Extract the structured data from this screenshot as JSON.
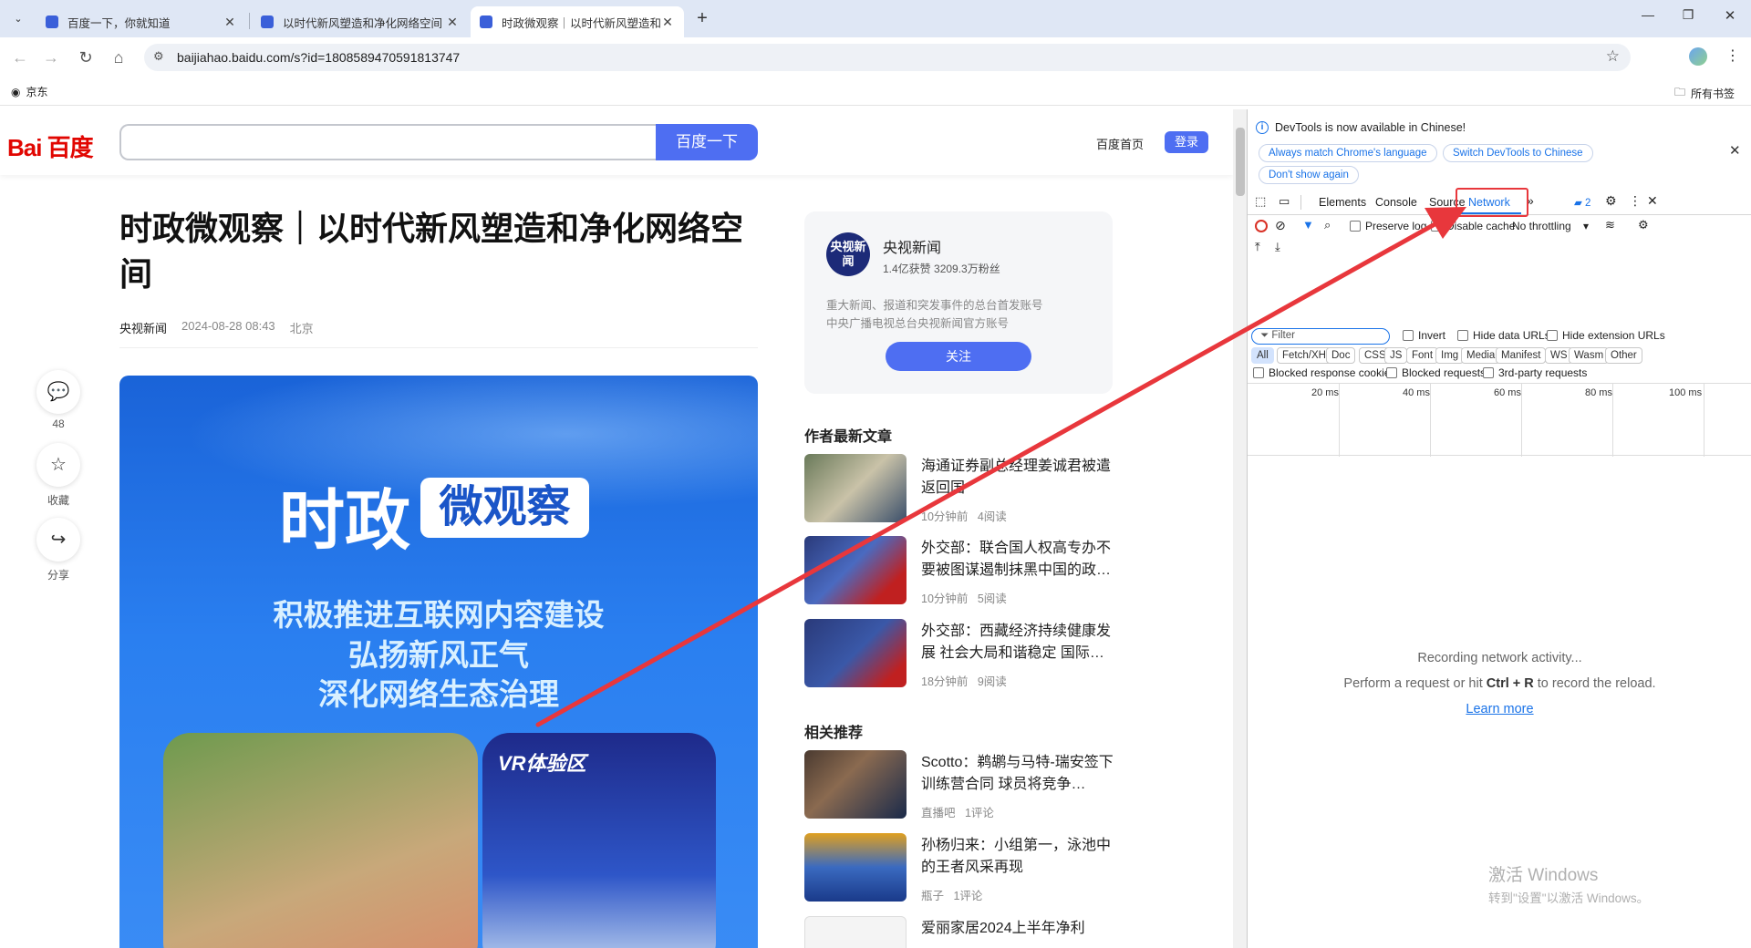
{
  "browser": {
    "tabs": [
      {
        "title": "百度一下，你就知道"
      },
      {
        "title": "以时代新风塑造和净化网络空间"
      },
      {
        "title": "时政微观察｜以时代新风塑造和"
      }
    ],
    "url": "baijiahao.baidu.com/s?id=1808589470591813747",
    "bookmark": "京东",
    "all_bookmarks": "所有书签"
  },
  "baidu": {
    "logo": "Bai 百度",
    "search_button": "百度一下",
    "home_link": "百度首页",
    "login_button": "登录"
  },
  "article": {
    "title": "时政微观察｜以时代新风塑造和净化网络空间",
    "author": "央视新闻",
    "date": "2024-08-28 08:43",
    "location": "北京",
    "banner": {
      "t1": "时政",
      "t2": "微观察",
      "line1": "积极推进互联网内容建设",
      "line2": "弘扬新风正气",
      "line3": "深化网络生态治理",
      "vr": "VR体验区"
    }
  },
  "side": {
    "comment_count": "48",
    "fav": "收藏",
    "share": "分享"
  },
  "author_card": {
    "avatar_text": "央视新闻",
    "name": "央视新闻",
    "stats": "1.4亿获赞 3209.3万粉丝",
    "desc1": "重大新闻、报道和突发事件的总台首发账号",
    "desc2": "中央广播电视总台央视新闻官方账号",
    "follow": "关注"
  },
  "latest": {
    "heading": "作者最新文章",
    "items": [
      {
        "title": "海通证券副总经理姜诚君被遣返回国",
        "time": "10分钟前",
        "reads": "4阅读"
      },
      {
        "title": "外交部：联合国人权高专办不要被图谋遏制抹黑中国的政…",
        "time": "10分钟前",
        "reads": "5阅读"
      },
      {
        "title": "外交部：西藏经济持续健康发展 社会大局和谐稳定 国际…",
        "time": "18分钟前",
        "reads": "9阅读"
      }
    ]
  },
  "related": {
    "heading": "相关推荐",
    "items": [
      {
        "title": "Scotto：鹈鹕与马特-瑞安签下训练营合同 球员将竞争…",
        "source": "直播吧",
        "comments": "1评论"
      },
      {
        "title": "孙杨归来：小组第一，泳池中的王者风采再现",
        "source": "瓶子",
        "comments": "1评论"
      },
      {
        "title": "爱丽家居2024上半年净利",
        "source": "",
        "comments": ""
      }
    ]
  },
  "devtools": {
    "notice": "DevTools is now available in Chinese!",
    "btn_match": "Always match Chrome's language",
    "btn_switch": "Switch DevTools to Chinese",
    "btn_dont": "Don't show again",
    "tabs": [
      "Elements",
      "Console",
      "Sources",
      "Network"
    ],
    "issues_count": "2",
    "preserve_log": "Preserve log",
    "disable_cache": "Disable cache",
    "throttling": "No throttling",
    "filter_placeholder": "Filter",
    "invert": "Invert",
    "hide_data": "Hide data URLs",
    "hide_ext": "Hide extension URLs",
    "types": [
      "All",
      "Fetch/XHR",
      "Doc",
      "CSS",
      "JS",
      "Font",
      "Img",
      "Media",
      "Manifest",
      "WS",
      "Wasm",
      "Other"
    ],
    "blocked_cookies": "Blocked response cookies",
    "blocked_requests": "Blocked requests",
    "third_party": "3rd-party requests",
    "timeline": [
      "20 ms",
      "40 ms",
      "60 ms",
      "80 ms",
      "100 ms"
    ],
    "recording": "Recording network activity...",
    "perform_pre": "Perform a request or hit",
    "perform_keys": "Ctrl + R",
    "perform_post": "to record the reload.",
    "learn_more": "Learn more"
  },
  "watermark": {
    "line1": "激活 Windows",
    "line2": "转到\"设置\"以激活 Windows。"
  },
  "colors": {
    "accent": "#4e6ef2",
    "annotation": "#e8373c",
    "devtools_blue": "#1a73e8"
  }
}
